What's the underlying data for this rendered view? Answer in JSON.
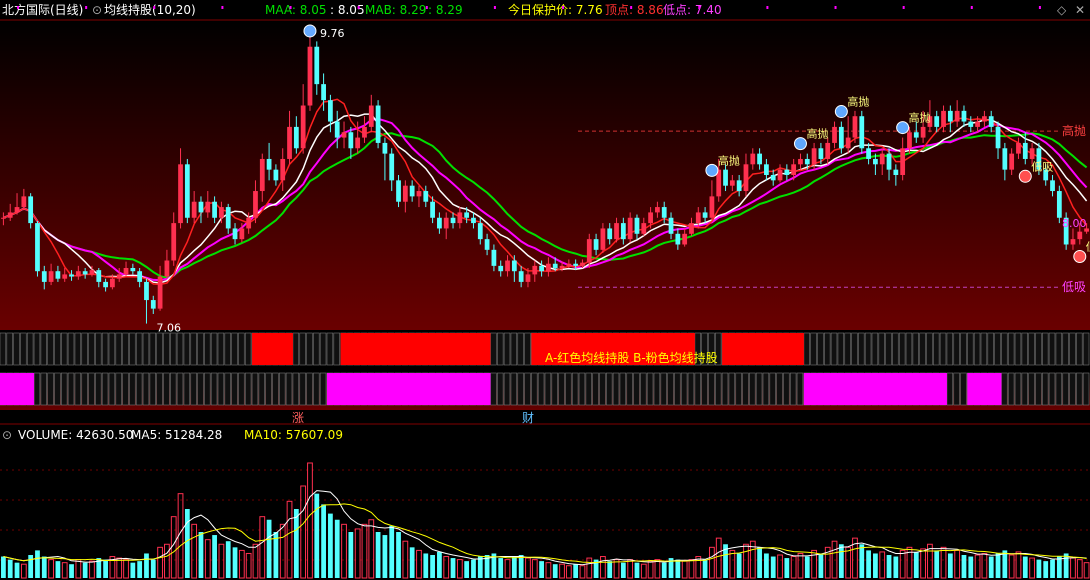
{
  "header": {
    "stock_name": "北方国际(日线)",
    "indicator_name": "均线持股(10,20)",
    "maa_label": "MAA: 8.05",
    "maa_value": ": 8.05",
    "mab_label": "MAB: 8.29",
    "mab_value": ": 8.29",
    "protect_label": "今日保护价: 7.76",
    "top_label": "顶点: 8.86",
    "bottom_label": "低点: 7.40"
  },
  "volume_header": {
    "volume": "VOLUME: 42630.50",
    "ma5": "MA5: 51284.28",
    "ma10": "MA10: 57607.09"
  },
  "annotations": {
    "high_price": "9.76",
    "low_price": "7.06",
    "high_throw": "高抛",
    "low_suck": "低吸",
    "right_price": "8.00",
    "band_caption": "A-红色均线持股 B-粉色均线持股",
    "marker_rise": "涨",
    "marker_fin": "财"
  },
  "colors": {
    "up": "#ff3050",
    "down": "#54ffff",
    "maa": "#00e000",
    "mab": "#ff00ff",
    "ma_white": "#ffffff",
    "ma_red": "#ff2020",
    "band_red": "#ff0000",
    "band_pink": "#ff00ff",
    "caption": "#ffff00",
    "dash_red": "#d03030",
    "dash_pink": "#c040c0"
  },
  "chart_data": {
    "type": "candlestick",
    "price_ylim": [
      7.0,
      9.9
    ],
    "reference_lines": {
      "high_throw": 8.86,
      "low_suck": 7.4
    },
    "candles": [
      [
        8.05,
        8.05,
        8.1,
        7.98
      ],
      [
        8.05,
        8.1,
        8.18,
        8.02
      ],
      [
        8.1,
        8.15,
        8.28,
        8.08
      ],
      [
        8.15,
        8.25,
        8.32,
        8.12
      ],
      [
        8.25,
        8.0,
        8.28,
        7.95
      ],
      [
        8.0,
        7.55,
        8.02,
        7.5
      ],
      [
        7.55,
        7.45,
        7.6,
        7.38
      ],
      [
        7.45,
        7.55,
        7.62,
        7.42
      ],
      [
        7.55,
        7.48,
        7.6,
        7.45
      ],
      [
        7.48,
        7.52,
        7.58,
        7.45
      ],
      [
        7.52,
        7.5,
        7.56,
        7.46
      ],
      [
        7.5,
        7.55,
        7.6,
        7.47
      ],
      [
        7.55,
        7.52,
        7.58,
        7.48
      ],
      [
        7.52,
        7.56,
        7.6,
        7.5
      ],
      [
        7.56,
        7.45,
        7.58,
        7.4
      ],
      [
        7.45,
        7.4,
        7.48,
        7.36
      ],
      [
        7.4,
        7.48,
        7.52,
        7.38
      ],
      [
        7.48,
        7.52,
        7.58,
        7.45
      ],
      [
        7.52,
        7.58,
        7.64,
        7.5
      ],
      [
        7.58,
        7.55,
        7.62,
        7.52
      ],
      [
        7.55,
        7.45,
        7.58,
        7.4
      ],
      [
        7.45,
        7.28,
        7.48,
        7.06
      ],
      [
        7.28,
        7.2,
        7.32,
        7.15
      ],
      [
        7.2,
        7.5,
        7.6,
        7.18
      ],
      [
        7.5,
        7.65,
        7.75,
        7.48
      ],
      [
        7.65,
        8.0,
        8.1,
        7.6
      ],
      [
        8.0,
        8.55,
        8.7,
        7.95
      ],
      [
        8.55,
        8.05,
        8.6,
        8.0
      ],
      [
        8.05,
        8.2,
        8.3,
        8.0
      ],
      [
        8.2,
        8.1,
        8.25,
        8.0
      ],
      [
        8.1,
        8.2,
        8.3,
        8.05
      ],
      [
        8.2,
        8.05,
        8.25,
        8.0
      ],
      [
        8.05,
        8.15,
        8.2,
        8.0
      ],
      [
        8.15,
        7.95,
        8.18,
        7.9
      ],
      [
        7.95,
        7.85,
        8.0,
        7.8
      ],
      [
        7.85,
        7.95,
        8.0,
        7.82
      ],
      [
        7.95,
        8.05,
        8.1,
        7.9
      ],
      [
        8.05,
        8.3,
        8.4,
        8.0
      ],
      [
        8.3,
        8.6,
        8.65,
        8.2
      ],
      [
        8.6,
        8.5,
        8.75,
        8.4
      ],
      [
        8.5,
        8.4,
        8.55,
        8.35
      ],
      [
        8.4,
        8.6,
        8.7,
        8.3
      ],
      [
        8.6,
        8.9,
        9.05,
        8.55
      ],
      [
        8.9,
        8.7,
        9.0,
        8.65
      ],
      [
        8.7,
        9.1,
        9.3,
        8.65
      ],
      [
        9.1,
        9.65,
        9.76,
        9.05
      ],
      [
        9.65,
        9.3,
        9.7,
        9.2
      ],
      [
        9.3,
        9.15,
        9.4,
        9.05
      ],
      [
        9.15,
        8.95,
        9.2,
        8.85
      ],
      [
        8.95,
        8.8,
        9.05,
        8.7
      ],
      [
        8.8,
        8.85,
        8.95,
        8.7
      ],
      [
        8.85,
        8.7,
        8.9,
        8.6
      ],
      [
        8.7,
        8.8,
        8.95,
        8.65
      ],
      [
        8.8,
        8.9,
        9.0,
        8.75
      ],
      [
        8.9,
        9.1,
        9.2,
        8.85
      ],
      [
        9.1,
        8.75,
        9.15,
        8.7
      ],
      [
        8.75,
        8.65,
        8.8,
        8.4
      ],
      [
        8.65,
        8.4,
        8.7,
        8.3
      ],
      [
        8.4,
        8.2,
        8.45,
        8.15
      ],
      [
        8.2,
        8.35,
        8.4,
        8.1
      ],
      [
        8.35,
        8.25,
        8.4,
        8.2
      ],
      [
        8.25,
        8.3,
        8.35,
        8.15
      ],
      [
        8.3,
        8.2,
        8.35,
        8.15
      ],
      [
        8.2,
        8.05,
        8.25,
        8.0
      ],
      [
        8.05,
        7.95,
        8.1,
        7.9
      ],
      [
        7.95,
        8.05,
        8.1,
        7.85
      ],
      [
        8.05,
        8.0,
        8.1,
        7.95
      ],
      [
        8.0,
        8.1,
        8.15,
        7.95
      ],
      [
        8.1,
        8.05,
        8.15,
        8.0
      ],
      [
        8.05,
        8.0,
        8.1,
        7.95
      ],
      [
        8.0,
        7.85,
        8.05,
        7.8
      ],
      [
        7.85,
        7.75,
        7.9,
        7.7
      ],
      [
        7.75,
        7.6,
        7.8,
        7.55
      ],
      [
        7.6,
        7.55,
        7.65,
        7.5
      ],
      [
        7.55,
        7.65,
        7.7,
        7.5
      ],
      [
        7.65,
        7.55,
        7.7,
        7.45
      ],
      [
        7.55,
        7.45,
        7.6,
        7.4
      ],
      [
        7.45,
        7.52,
        7.58,
        7.4
      ],
      [
        7.52,
        7.6,
        7.65,
        7.45
      ],
      [
        7.6,
        7.55,
        7.65,
        7.5
      ],
      [
        7.55,
        7.62,
        7.68,
        7.5
      ],
      [
        7.62,
        7.58,
        7.68,
        7.55
      ],
      [
        7.58,
        7.6,
        7.64,
        7.55
      ],
      [
        7.6,
        7.62,
        7.66,
        7.58
      ],
      [
        7.62,
        7.6,
        7.66,
        7.56
      ],
      [
        7.6,
        7.63,
        7.66,
        7.58
      ],
      [
        7.63,
        7.85,
        7.9,
        7.58
      ],
      [
        7.85,
        7.75,
        7.9,
        7.7
      ],
      [
        7.75,
        7.95,
        8.0,
        7.72
      ],
      [
        7.95,
        7.85,
        8.0,
        7.8
      ],
      [
        7.85,
        8.0,
        8.05,
        7.82
      ],
      [
        8.0,
        7.85,
        8.05,
        7.8
      ],
      [
        7.85,
        8.05,
        8.1,
        7.82
      ],
      [
        8.05,
        7.9,
        8.08,
        7.85
      ],
      [
        7.9,
        8.0,
        8.05,
        7.88
      ],
      [
        8.0,
        8.1,
        8.15,
        7.95
      ],
      [
        8.1,
        8.15,
        8.2,
        8.05
      ],
      [
        8.15,
        8.05,
        8.2,
        8.0
      ],
      [
        8.05,
        7.9,
        8.1,
        7.85
      ],
      [
        7.9,
        7.8,
        7.95,
        7.75
      ],
      [
        7.8,
        7.9,
        7.95,
        7.78
      ],
      [
        7.9,
        8.0,
        8.05,
        7.88
      ],
      [
        8.0,
        8.1,
        8.15,
        7.95
      ],
      [
        8.1,
        8.05,
        8.15,
        8.0
      ],
      [
        8.05,
        8.25,
        8.4,
        8.02
      ],
      [
        8.25,
        8.5,
        8.6,
        8.2
      ],
      [
        8.5,
        8.35,
        8.55,
        8.3
      ],
      [
        8.35,
        8.4,
        8.45,
        8.3
      ],
      [
        8.4,
        8.3,
        8.45,
        8.25
      ],
      [
        8.3,
        8.55,
        8.65,
        8.25
      ],
      [
        8.55,
        8.65,
        8.7,
        8.5
      ],
      [
        8.65,
        8.55,
        8.7,
        8.5
      ],
      [
        8.55,
        8.45,
        8.6,
        8.4
      ],
      [
        8.45,
        8.4,
        8.5,
        8.35
      ],
      [
        8.4,
        8.5,
        8.55,
        8.38
      ],
      [
        8.5,
        8.45,
        8.55,
        8.4
      ],
      [
        8.45,
        8.55,
        8.6,
        8.4
      ],
      [
        8.55,
        8.6,
        8.65,
        8.5
      ],
      [
        8.6,
        8.55,
        8.65,
        8.5
      ],
      [
        8.55,
        8.7,
        8.75,
        8.5
      ],
      [
        8.7,
        8.6,
        8.75,
        8.55
      ],
      [
        8.6,
        8.75,
        8.8,
        8.55
      ],
      [
        8.75,
        8.9,
        8.95,
        8.7
      ],
      [
        8.9,
        8.7,
        8.95,
        8.65
      ],
      [
        8.7,
        8.8,
        9.0,
        8.65
      ],
      [
        8.8,
        9.0,
        9.05,
        8.75
      ],
      [
        9.0,
        8.7,
        9.05,
        8.65
      ],
      [
        8.7,
        8.6,
        8.75,
        8.55
      ],
      [
        8.6,
        8.55,
        8.65,
        8.45
      ],
      [
        8.55,
        8.65,
        8.7,
        8.45
      ],
      [
        8.65,
        8.5,
        8.7,
        8.4
      ],
      [
        8.5,
        8.45,
        8.55,
        8.35
      ],
      [
        8.45,
        8.7,
        8.8,
        8.4
      ],
      [
        8.7,
        8.85,
        8.9,
        8.65
      ],
      [
        8.85,
        8.8,
        8.95,
        8.75
      ],
      [
        8.8,
        8.9,
        9.05,
        8.75
      ],
      [
        8.9,
        9.0,
        9.15,
        8.85
      ],
      [
        9.0,
        8.9,
        9.05,
        8.85
      ],
      [
        8.9,
        9.05,
        9.1,
        8.85
      ],
      [
        9.05,
        8.95,
        9.1,
        8.85
      ],
      [
        8.95,
        9.05,
        9.15,
        8.9
      ],
      [
        9.05,
        8.95,
        9.1,
        8.9
      ],
      [
        8.95,
        8.9,
        9.0,
        8.85
      ],
      [
        8.9,
        8.95,
        9.0,
        8.85
      ],
      [
        8.95,
        9.0,
        9.05,
        8.9
      ],
      [
        9.0,
        8.9,
        9.05,
        8.85
      ],
      [
        8.9,
        8.7,
        8.95,
        8.6
      ],
      [
        8.7,
        8.5,
        8.75,
        8.4
      ],
      [
        8.5,
        8.65,
        8.7,
        8.45
      ],
      [
        8.65,
        8.75,
        8.8,
        8.6
      ],
      [
        8.75,
        8.6,
        8.85,
        8.55
      ],
      [
        8.6,
        8.7,
        8.75,
        8.55
      ],
      [
        8.7,
        8.5,
        8.75,
        8.45
      ],
      [
        8.5,
        8.4,
        8.55,
        8.35
      ],
      [
        8.4,
        8.3,
        8.45,
        8.25
      ],
      [
        8.3,
        8.05,
        8.35,
        8.0
      ],
      [
        8.05,
        7.8,
        8.1,
        7.75
      ],
      [
        7.8,
        7.85,
        7.95,
        7.75
      ],
      [
        7.85,
        7.92,
        8.0,
        7.8
      ],
      [
        7.92,
        7.95,
        8.0,
        7.9
      ]
    ],
    "volumes": [
      [
        14000,
        0
      ],
      [
        12000,
        0
      ],
      [
        10000,
        0
      ],
      [
        9000,
        1
      ],
      [
        15000,
        0
      ],
      [
        18000,
        0
      ],
      [
        14000,
        0
      ],
      [
        12000,
        1
      ],
      [
        11000,
        0
      ],
      [
        10000,
        1
      ],
      [
        9000,
        0
      ],
      [
        12000,
        1
      ],
      [
        10000,
        0
      ],
      [
        11000,
        1
      ],
      [
        13000,
        0
      ],
      [
        12000,
        0
      ],
      [
        14000,
        1
      ],
      [
        13000,
        1
      ],
      [
        12000,
        1
      ],
      [
        10000,
        0
      ],
      [
        11000,
        0
      ],
      [
        16000,
        0
      ],
      [
        12000,
        0
      ],
      [
        20000,
        1
      ],
      [
        22000,
        1
      ],
      [
        40000,
        1
      ],
      [
        55000,
        1
      ],
      [
        45000,
        0
      ],
      [
        35000,
        1
      ],
      [
        30000,
        0
      ],
      [
        25000,
        1
      ],
      [
        28000,
        0
      ],
      [
        22000,
        1
      ],
      [
        24000,
        0
      ],
      [
        20000,
        0
      ],
      [
        18000,
        1
      ],
      [
        16000,
        1
      ],
      [
        22000,
        1
      ],
      [
        40000,
        1
      ],
      [
        38000,
        0
      ],
      [
        30000,
        0
      ],
      [
        35000,
        1
      ],
      [
        50000,
        1
      ],
      [
        45000,
        0
      ],
      [
        60000,
        1
      ],
      [
        75000,
        1
      ],
      [
        55000,
        0
      ],
      [
        48000,
        0
      ],
      [
        42000,
        0
      ],
      [
        38000,
        0
      ],
      [
        35000,
        1
      ],
      [
        30000,
        0
      ],
      [
        32000,
        1
      ],
      [
        35000,
        1
      ],
      [
        38000,
        1
      ],
      [
        30000,
        0
      ],
      [
        28000,
        0
      ],
      [
        34000,
        0
      ],
      [
        30000,
        0
      ],
      [
        24000,
        1
      ],
      [
        20000,
        0
      ],
      [
        18000,
        1
      ],
      [
        16000,
        0
      ],
      [
        15000,
        0
      ],
      [
        17000,
        0
      ],
      [
        14000,
        1
      ],
      [
        13000,
        0
      ],
      [
        12000,
        1
      ],
      [
        11000,
        0
      ],
      [
        12000,
        0
      ],
      [
        14000,
        0
      ],
      [
        15000,
        0
      ],
      [
        16000,
        0
      ],
      [
        13000,
        0
      ],
      [
        12000,
        1
      ],
      [
        14000,
        0
      ],
      [
        15000,
        0
      ],
      [
        13000,
        1
      ],
      [
        12000,
        1
      ],
      [
        11000,
        0
      ],
      [
        10000,
        1
      ],
      [
        9000,
        0
      ],
      [
        9000,
        1
      ],
      [
        8000,
        1
      ],
      [
        9000,
        0
      ],
      [
        8000,
        1
      ],
      [
        13000,
        1
      ],
      [
        12000,
        0
      ],
      [
        14000,
        1
      ],
      [
        11000,
        0
      ],
      [
        12000,
        1
      ],
      [
        10000,
        0
      ],
      [
        12000,
        1
      ],
      [
        10000,
        0
      ],
      [
        9000,
        1
      ],
      [
        11000,
        1
      ],
      [
        12000,
        1
      ],
      [
        10000,
        0
      ],
      [
        13000,
        0
      ],
      [
        12000,
        0
      ],
      [
        11000,
        1
      ],
      [
        12000,
        1
      ],
      [
        14000,
        1
      ],
      [
        12000,
        0
      ],
      [
        20000,
        1
      ],
      [
        26000,
        1
      ],
      [
        22000,
        0
      ],
      [
        18000,
        1
      ],
      [
        16000,
        0
      ],
      [
        22000,
        1
      ],
      [
        24000,
        1
      ],
      [
        20000,
        0
      ],
      [
        16000,
        0
      ],
      [
        14000,
        0
      ],
      [
        15000,
        1
      ],
      [
        13000,
        0
      ],
      [
        14000,
        1
      ],
      [
        16000,
        1
      ],
      [
        14000,
        0
      ],
      [
        18000,
        1
      ],
      [
        16000,
        0
      ],
      [
        20000,
        1
      ],
      [
        24000,
        1
      ],
      [
        22000,
        0
      ],
      [
        20000,
        1
      ],
      [
        26000,
        1
      ],
      [
        22000,
        0
      ],
      [
        18000,
        0
      ],
      [
        16000,
        0
      ],
      [
        17000,
        1
      ],
      [
        15000,
        0
      ],
      [
        14000,
        0
      ],
      [
        18000,
        1
      ],
      [
        20000,
        1
      ],
      [
        17000,
        0
      ],
      [
        19000,
        1
      ],
      [
        22000,
        1
      ],
      [
        18000,
        0
      ],
      [
        20000,
        1
      ],
      [
        16000,
        0
      ],
      [
        18000,
        1
      ],
      [
        15000,
        0
      ],
      [
        14000,
        0
      ],
      [
        15000,
        1
      ],
      [
        16000,
        1
      ],
      [
        14000,
        0
      ],
      [
        16000,
        0
      ],
      [
        18000,
        0
      ],
      [
        15000,
        1
      ],
      [
        17000,
        1
      ],
      [
        14000,
        0
      ],
      [
        13000,
        1
      ],
      [
        12000,
        0
      ],
      [
        11000,
        0
      ],
      [
        12000,
        0
      ],
      [
        14000,
        0
      ],
      [
        16000,
        0
      ],
      [
        13000,
        1
      ],
      [
        12000,
        1
      ],
      [
        10000,
        1
      ]
    ],
    "volume_ylim": [
      0,
      90000
    ],
    "band_a_red_ranges": [
      [
        23,
        27
      ],
      [
        31,
        45
      ],
      [
        49,
        64
      ],
      [
        66,
        74
      ]
    ],
    "band_b_pink_ranges": [
      [
        0,
        3
      ],
      [
        30,
        45
      ],
      [
        74,
        87
      ],
      [
        89,
        92
      ]
    ]
  }
}
